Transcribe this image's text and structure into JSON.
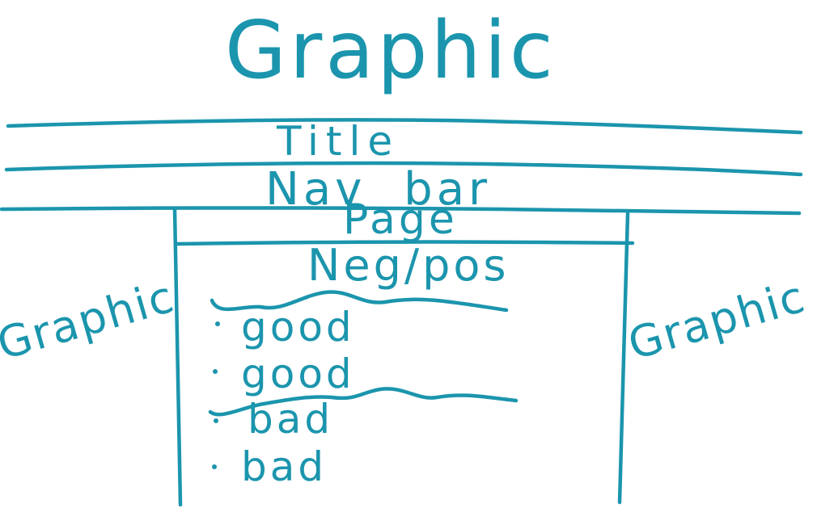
{
  "colors": {
    "ink": "#1b95ad",
    "background": "#ffffff"
  },
  "labels": {
    "top_graphic": "Graphic",
    "title": "Title",
    "nav_bar": "Nav bar",
    "page": "Page",
    "negpos": "Neg/pos",
    "left_graphic": "Graphic",
    "right_graphic": "Graphic"
  },
  "list_items": [
    "good",
    "good",
    "bad",
    "bad"
  ]
}
